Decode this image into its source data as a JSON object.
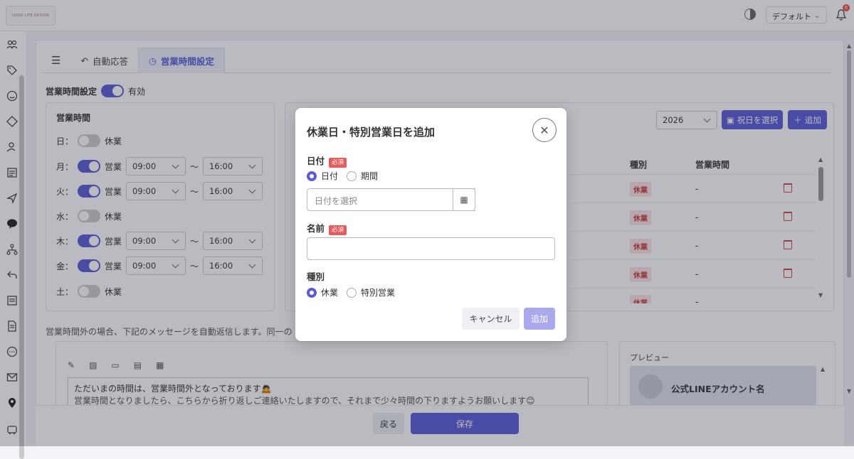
{
  "header": {
    "logo_text": "LOGO·LIFE·DESIGN",
    "theme_select": "デフォルト",
    "notification_count": "6"
  },
  "tabs": [
    {
      "label": ""
    },
    {
      "label": "自動応答"
    },
    {
      "label": "営業時間設定"
    }
  ],
  "business_hours": {
    "setting_label": "営業時間設定",
    "status_label": "有効",
    "panel_title": "営業時間",
    "days": [
      {
        "day": "日：",
        "status": "休業"
      },
      {
        "day": "月：",
        "status": "営業",
        "start": "09:00",
        "end": "16:00"
      },
      {
        "day": "火：",
        "status": "営業",
        "start": "09:00",
        "end": "16:00"
      },
      {
        "day": "水：",
        "status": "休業"
      },
      {
        "day": "木：",
        "status": "営業",
        "start": "09:00",
        "end": "16:00"
      },
      {
        "day": "金：",
        "status": "営業",
        "start": "09:00",
        "end": "16:00"
      },
      {
        "day": "土：",
        "status": "休業"
      }
    ],
    "separator": "〜"
  },
  "holidays": {
    "year": "2026",
    "select_holiday_label": "祝日を選択",
    "add_label": "追加",
    "col_type": "種別",
    "col_hours": "営業時間",
    "rows": [
      {
        "type": "休業",
        "hours": "-"
      },
      {
        "type": "休業",
        "hours": "-"
      },
      {
        "type": "休業",
        "hours": "-"
      },
      {
        "type": "休業",
        "hours": "-"
      },
      {
        "type": "休業",
        "hours": "-"
      }
    ]
  },
  "message": {
    "description": "営業時間外の場合、下記のメッセージを自動返信します。同一の",
    "body_line1": "ただいまの時間は、営業時間外となっております🙇",
    "body_line2": "営業時間となりましたら、こちらから折り返しご連絡いたしますので、それまで少々時間の下りますようお願いします😊"
  },
  "preview": {
    "title": "プレビュー",
    "account_name": "公式LINEアカウント名"
  },
  "footer": {
    "back_label": "戻る",
    "save_label": "保存"
  },
  "modal": {
    "title": "休業日・特別営業日を追加",
    "date_label": "日付",
    "required": "必須",
    "radio_date": "日付",
    "radio_period": "期間",
    "date_placeholder": "日付を選択",
    "name_label": "名前",
    "type_label": "種別",
    "radio_closed": "休業",
    "radio_special": "特別営業",
    "cancel_label": "キャンセル",
    "add_label": "追加"
  }
}
